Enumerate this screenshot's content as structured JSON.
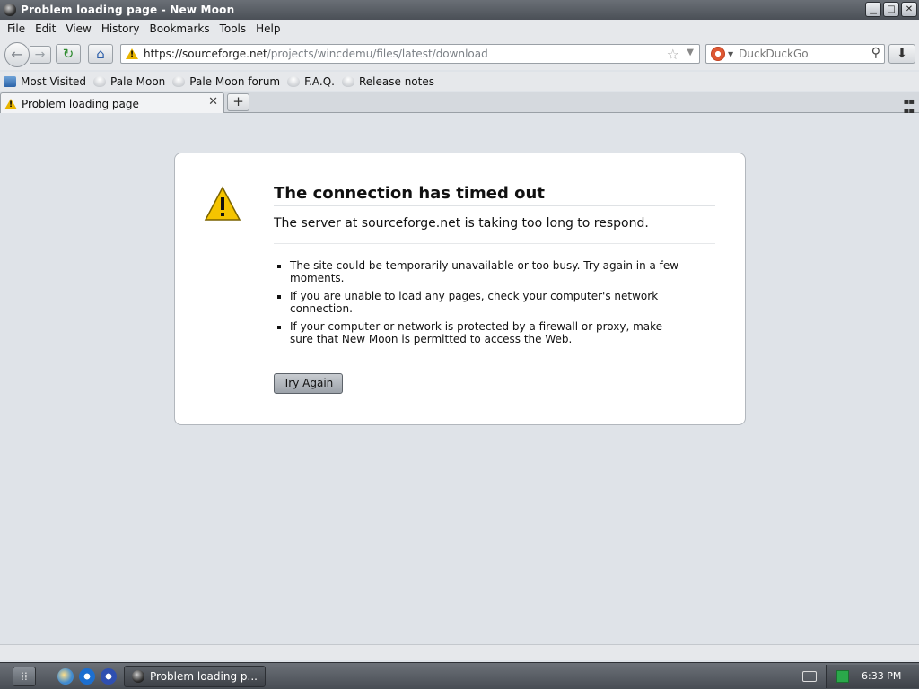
{
  "window": {
    "title": "Problem loading page - New Moon",
    "controls": [
      "minimize",
      "maximize",
      "close"
    ]
  },
  "menu": [
    "File",
    "Edit",
    "View",
    "History",
    "Bookmarks",
    "Tools",
    "Help"
  ],
  "nav": {
    "url_host": "https://sourceforge.net",
    "url_path": "/projects/wincdemu/files/latest/download",
    "search_engine": "DuckDuckGo"
  },
  "bookmarks": [
    "Most Visited",
    "Pale Moon",
    "Pale Moon forum",
    "F.A.Q.",
    "Release notes"
  ],
  "tab": {
    "label": "Problem loading page",
    "close": "✕",
    "new": "+"
  },
  "error": {
    "title": "The connection has timed out",
    "subtitle": "The server at sourceforge.net is taking too long to respond.",
    "items": [
      "The site could be temporarily unavailable or too busy. Try again in a few moments.",
      "If you are unable to load any pages, check your computer's network connection.",
      "If your computer or network is protected by a firewall or proxy, make sure that New Moon is permitted to access the Web."
    ],
    "button": "Try Again"
  },
  "taskbar": {
    "task_label": "Problem loading p...",
    "clock": "6:33 PM"
  },
  "colors": {
    "warning": "#e8b400",
    "page_bg": "#dfe3e8"
  }
}
